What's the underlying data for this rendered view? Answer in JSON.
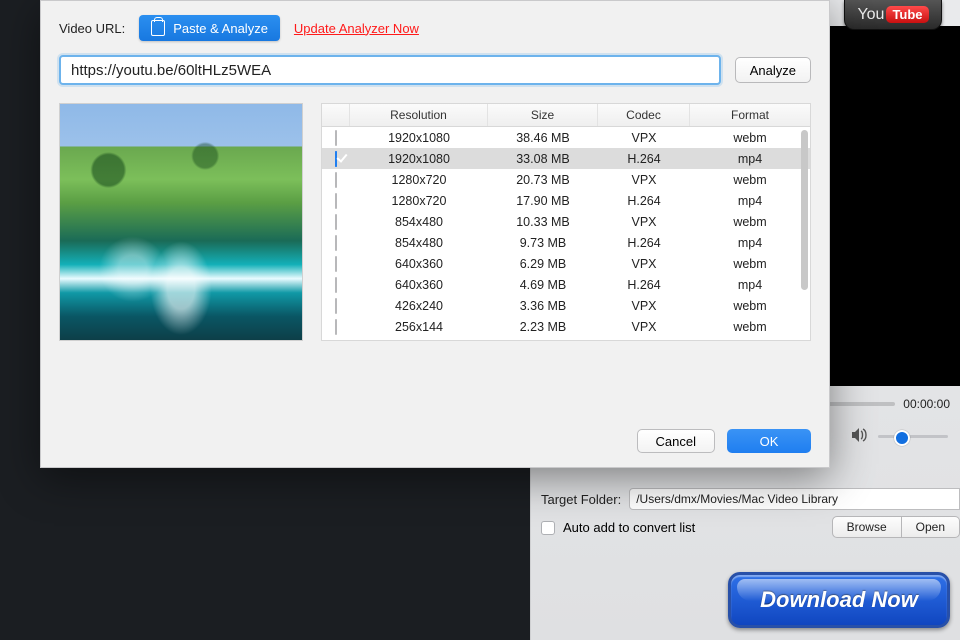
{
  "header": {
    "video_url_label": "Video URL:",
    "paste_btn": "Paste & Analyze",
    "update_link": "Update Analyzer Now"
  },
  "url_input": "https://youtu.be/60ltHLz5WEA",
  "analyze_btn": "Analyze",
  "table": {
    "headers": {
      "resolution": "Resolution",
      "size": "Size",
      "codec": "Codec",
      "format": "Format"
    },
    "rows": [
      {
        "checked": false,
        "resolution": "1920x1080",
        "size": "38.46 MB",
        "codec": "VPX",
        "format": "webm"
      },
      {
        "checked": true,
        "resolution": "1920x1080",
        "size": "33.08 MB",
        "codec": "H.264",
        "format": "mp4"
      },
      {
        "checked": false,
        "resolution": "1280x720",
        "size": "20.73 MB",
        "codec": "VPX",
        "format": "webm"
      },
      {
        "checked": false,
        "resolution": "1280x720",
        "size": "17.90 MB",
        "codec": "H.264",
        "format": "mp4"
      },
      {
        "checked": false,
        "resolution": "854x480",
        "size": "10.33 MB",
        "codec": "VPX",
        "format": "webm"
      },
      {
        "checked": false,
        "resolution": "854x480",
        "size": "9.73 MB",
        "codec": "H.264",
        "format": "mp4"
      },
      {
        "checked": false,
        "resolution": "640x360",
        "size": "6.29 MB",
        "codec": "VPX",
        "format": "webm"
      },
      {
        "checked": false,
        "resolution": "640x360",
        "size": "4.69 MB",
        "codec": "H.264",
        "format": "mp4"
      },
      {
        "checked": false,
        "resolution": "426x240",
        "size": "3.36 MB",
        "codec": "VPX",
        "format": "webm"
      },
      {
        "checked": false,
        "resolution": "256x144",
        "size": "2.23 MB",
        "codec": "VPX",
        "format": "webm"
      }
    ]
  },
  "footer": {
    "cancel": "Cancel",
    "ok": "OK"
  },
  "player": {
    "time": "00:00:00",
    "target_label": "Target Folder:",
    "target_path": "/Users/dmx/Movies/Mac Video Library",
    "auto_add": "Auto add to convert list",
    "browse": "Browse",
    "open": "Open",
    "download": "Download Now"
  },
  "yt": {
    "you": "You",
    "tube": "Tube"
  }
}
